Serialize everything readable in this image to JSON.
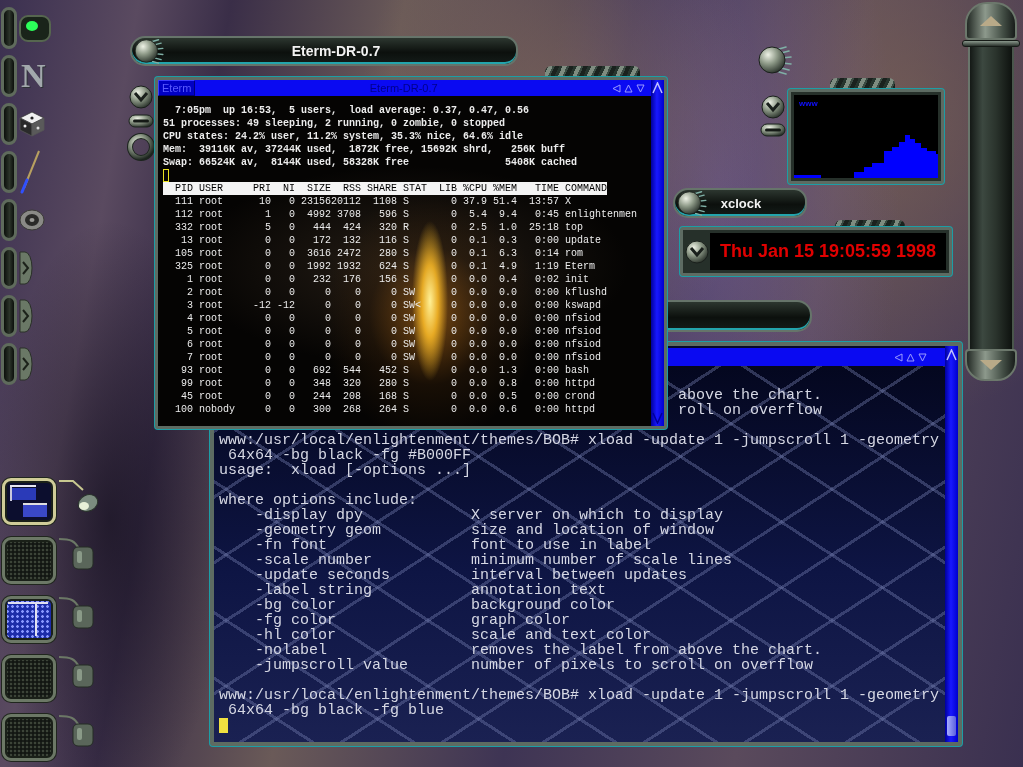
{
  "dock": {
    "items": [
      {
        "kind": "led",
        "on": true
      },
      {
        "kind": "letter",
        "glyph": "N"
      },
      {
        "kind": "die"
      },
      {
        "kind": "pen"
      },
      {
        "kind": "speaker"
      },
      {
        "kind": "knob"
      },
      {
        "kind": "knob"
      },
      {
        "kind": "knob"
      }
    ]
  },
  "pager": {
    "desks": [
      {
        "kind": "windows",
        "selected": true
      },
      {
        "kind": "empty",
        "selected": false
      },
      {
        "kind": "blue",
        "selected": false
      },
      {
        "kind": "empty",
        "selected": false
      },
      {
        "kind": "empty",
        "selected": false
      }
    ]
  },
  "front_terminal": {
    "tab_title": "Eterm-DR-0.7",
    "menu_button": "Eterm",
    "title": "Eterm-DR-0.7",
    "summary": [
      {
        "kind": "uptime",
        "text": "7:05pm  up 16:53,  5 users,  load average: 0.37, 0.47, 0.56"
      },
      {
        "kind": "tasks",
        "text": "51 processes: 49 sleeping, 2 running, 0 zombie, 0 stopped"
      },
      {
        "kind": "cpu",
        "text": "CPU states: 24.2% user, 11.2% system, 35.3% nice, 64.6% idle"
      },
      {
        "kind": "memory",
        "text": "Mem:  39116K av, 37244K used,  1872K free, 15692K shrd,   256K buff"
      },
      {
        "kind": "swap",
        "text": "Swap: 66524K av,  8144K used, 58328K free",
        "cached": "5408K cached"
      }
    ],
    "cursor": {
      "focused": false
    },
    "table": {
      "columns": [
        "PID",
        "USER",
        "PRI",
        "NI",
        "SIZE",
        "RSS",
        "SHARE",
        "STAT",
        "LIB",
        "%CPU",
        "%MEM",
        "TIME",
        "COMMAND"
      ],
      "rows": [
        [
          "111",
          "root",
          "10",
          "0",
          "23156",
          "20112",
          "1108",
          "S",
          "0",
          "37.9",
          "51.4",
          "13:57",
          "X"
        ],
        [
          "112",
          "root",
          "1",
          "0",
          "4992",
          "3708",
          "596",
          "S",
          "0",
          "5.4",
          "9.4",
          "0:45",
          "enlightenmen"
        ],
        [
          "332",
          "root",
          "5",
          "0",
          "444",
          "424",
          "320",
          "R",
          "0",
          "2.5",
          "1.0",
          "25:18",
          "top"
        ],
        [
          "13",
          "root",
          "0",
          "0",
          "172",
          "132",
          "116",
          "S",
          "0",
          "0.1",
          "0.3",
          "0:00",
          "update"
        ],
        [
          "105",
          "root",
          "0",
          "0",
          "3616",
          "2472",
          "280",
          "S",
          "0",
          "0.1",
          "6.3",
          "0:14",
          "rom"
        ],
        [
          "325",
          "root",
          "0",
          "0",
          "1992",
          "1932",
          "624",
          "S",
          "0",
          "0.1",
          "4.9",
          "1:19",
          "Eterm"
        ],
        [
          "1",
          "root",
          "0",
          "0",
          "232",
          "176",
          "156",
          "S",
          "0",
          "0.0",
          "0.4",
          "0:02",
          "init"
        ],
        [
          "2",
          "root",
          "0",
          "0",
          "0",
          "0",
          "0",
          "SW",
          "0",
          "0.0",
          "0.0",
          "0:00",
          "kflushd"
        ],
        [
          "3",
          "root",
          "-12",
          "-12",
          "0",
          "0",
          "0",
          "SW<",
          "0",
          "0.0",
          "0.0",
          "0:00",
          "kswapd"
        ],
        [
          "4",
          "root",
          "0",
          "0",
          "0",
          "0",
          "0",
          "SW",
          "0",
          "0.0",
          "0.0",
          "0:00",
          "nfsiod"
        ],
        [
          "5",
          "root",
          "0",
          "0",
          "0",
          "0",
          "0",
          "SW",
          "0",
          "0.0",
          "0.0",
          "0:00",
          "nfsiod"
        ],
        [
          "6",
          "root",
          "0",
          "0",
          "0",
          "0",
          "0",
          "SW",
          "0",
          "0.0",
          "0.0",
          "0:00",
          "nfsiod"
        ],
        [
          "7",
          "root",
          "0",
          "0",
          "0",
          "0",
          "0",
          "SW",
          "0",
          "0.0",
          "0.0",
          "0:00",
          "nfsiod"
        ],
        [
          "93",
          "root",
          "0",
          "0",
          "692",
          "544",
          "452",
          "S",
          "0",
          "0.0",
          "1.3",
          "0:00",
          "bash"
        ],
        [
          "99",
          "root",
          "0",
          "0",
          "348",
          "320",
          "280",
          "S",
          "0",
          "0.0",
          "0.8",
          "0:00",
          "httpd"
        ],
        [
          "45",
          "root",
          "0",
          "0",
          "244",
          "208",
          "168",
          "S",
          "0",
          "0.0",
          "0.5",
          "0:00",
          "crond"
        ],
        [
          "100",
          "nobody",
          "0",
          "0",
          "300",
          "268",
          "264",
          "S",
          "0",
          "0.0",
          "0.6",
          "0:00",
          "httpd"
        ]
      ]
    }
  },
  "back_terminal": {
    "lines": [
      {
        "kind": "clipped",
        "text": "above the chart."
      },
      {
        "kind": "clipped",
        "text": "roll on overflow"
      },
      {
        "kind": "blank"
      },
      {
        "kind": "text",
        "text": "www:/usr/local/enlightenment/themes/BOB# xload -update 1 -jumpscroll 1 -geometry"
      },
      {
        "kind": "continued",
        "text": "64x64 -bg black -fg #B000FF"
      },
      {
        "kind": "text",
        "text": "usage:  xload [-options ...]"
      },
      {
        "kind": "blank"
      },
      {
        "kind": "text",
        "text": "where options include:"
      },
      {
        "kind": "option",
        "option": "-display dpy",
        "description": "X server on which to display"
      },
      {
        "kind": "option",
        "option": "-geometry geom",
        "description": "size and location of window"
      },
      {
        "kind": "option",
        "option": "-fn font",
        "description": "font to use in label"
      },
      {
        "kind": "option",
        "option": "-scale number",
        "description": "minimum number of scale lines"
      },
      {
        "kind": "option",
        "option": "-update seconds",
        "description": "interval between updates"
      },
      {
        "kind": "option",
        "option": "-label string",
        "description": "annotation text"
      },
      {
        "kind": "option",
        "option": "-bg color",
        "description": "background color"
      },
      {
        "kind": "option",
        "option": "-fg color",
        "description": "graph color"
      },
      {
        "kind": "option",
        "option": "-hl color",
        "description": "scale and text color"
      },
      {
        "kind": "option",
        "option": "-nolabel",
        "description": "removes the label from above the chart."
      },
      {
        "kind": "option",
        "option": "-jumpscroll value",
        "description": "number of pixels to scroll on overflow"
      },
      {
        "kind": "blank"
      },
      {
        "kind": "text",
        "text": "www:/usr/local/enlightenment/themes/BOB# xload -update 1 -jumpscroll 1 -geometry"
      },
      {
        "kind": "continued",
        "text": "64x64 -bg black -fg blue"
      }
    ],
    "cursor": {
      "focused": true
    }
  },
  "xload": {
    "label": "www"
  },
  "xclock": {
    "title": "xclock",
    "time": "Thu Jan 15 19:05:59 1998"
  }
}
